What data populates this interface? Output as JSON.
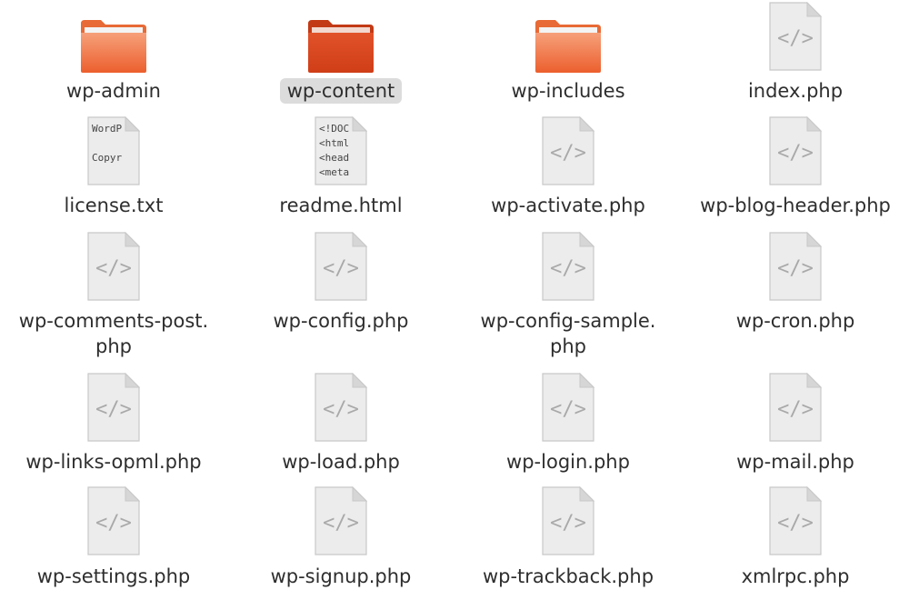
{
  "file_manager": {
    "items": [
      {
        "label": "wp-admin",
        "type": "folder",
        "icon": "folder-icon",
        "selected": false
      },
      {
        "label": "wp-content",
        "type": "folder",
        "icon": "folder-icon",
        "selected": true
      },
      {
        "label": "wp-includes",
        "type": "folder",
        "icon": "folder-icon",
        "selected": false
      },
      {
        "label": "index.php",
        "type": "php",
        "icon": "php-file-icon",
        "selected": false
      },
      {
        "label": "license.txt",
        "type": "txt",
        "icon": "text-file-icon",
        "preview": [
          "WordP",
          "",
          "Copyr"
        ],
        "selected": false
      },
      {
        "label": "readme.html",
        "type": "html",
        "icon": "html-file-icon",
        "preview": [
          "<!DOC",
          "<html",
          "<head",
          "<meta"
        ],
        "selected": false
      },
      {
        "label": "wp-activate.php",
        "type": "php",
        "icon": "php-file-icon",
        "selected": false
      },
      {
        "label": "wp-blog-header.php",
        "type": "php",
        "icon": "php-file-icon",
        "selected": false
      },
      {
        "label": "wp-comments-post.\nphp",
        "type": "php",
        "icon": "php-file-icon",
        "selected": false
      },
      {
        "label": "wp-config.php",
        "type": "php",
        "icon": "php-file-icon",
        "selected": false
      },
      {
        "label": "wp-config-sample.\nphp",
        "type": "php",
        "icon": "php-file-icon",
        "selected": false
      },
      {
        "label": "wp-cron.php",
        "type": "php",
        "icon": "php-file-icon",
        "selected": false
      },
      {
        "label": "wp-links-opml.php",
        "type": "php",
        "icon": "php-file-icon",
        "selected": false
      },
      {
        "label": "wp-load.php",
        "type": "php",
        "icon": "php-file-icon",
        "selected": false
      },
      {
        "label": "wp-login.php",
        "type": "php",
        "icon": "php-file-icon",
        "selected": false
      },
      {
        "label": "wp-mail.php",
        "type": "php",
        "icon": "php-file-icon",
        "selected": false
      },
      {
        "label": "wp-settings.php",
        "type": "php",
        "icon": "php-file-icon",
        "selected": false
      },
      {
        "label": "wp-signup.php",
        "type": "php",
        "icon": "php-file-icon",
        "selected": false
      },
      {
        "label": "wp-trackback.php",
        "type": "php",
        "icon": "php-file-icon",
        "selected": false
      },
      {
        "label": "xmlrpc.php",
        "type": "php",
        "icon": "php-file-icon",
        "selected": false
      }
    ]
  },
  "colors": {
    "folder_light": "#f08a5a",
    "folder_dark": "#e9532a",
    "selected_folder": "#e0471f",
    "file_page": "#ececec",
    "file_border": "#c8c8c8",
    "selection_bg": "#dcdcdc",
    "text": "#2e2e2e"
  }
}
